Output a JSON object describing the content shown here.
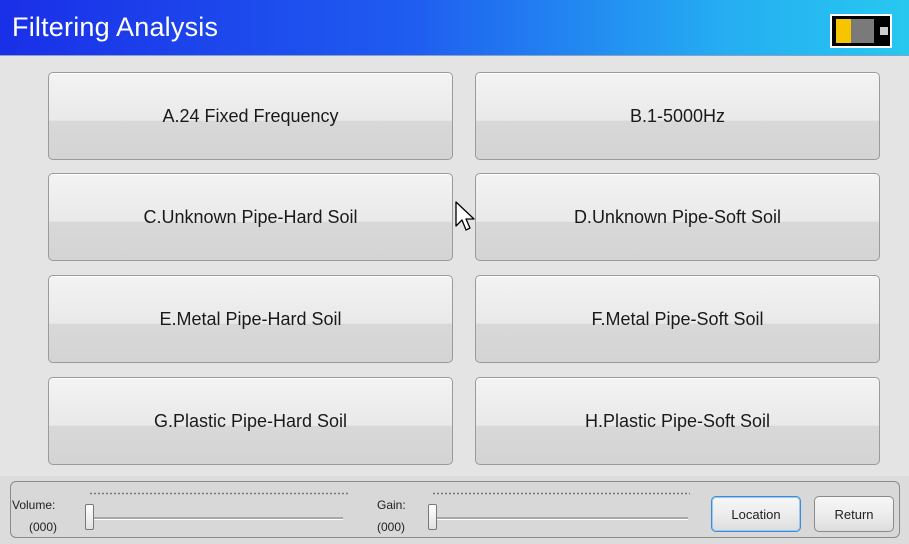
{
  "header": {
    "title": "Filtering Analysis",
    "battery_icon": "battery-icon"
  },
  "menu": {
    "options": [
      "A.24 Fixed Frequency",
      "B.1-5000Hz",
      "C.Unknown Pipe-Hard Soil",
      "D.Unknown Pipe-Soft Soil",
      "E.Metal Pipe-Hard Soil",
      "F.Metal Pipe-Soft Soil",
      "G.Plastic Pipe-Hard Soil",
      "H.Plastic Pipe-Soft Soil"
    ]
  },
  "controls": {
    "volume_label": "Volume:",
    "volume_value": "(000)",
    "gain_label": "Gain:",
    "gain_value": "(000)",
    "location_label": "Location",
    "return_label": "Return"
  },
  "colors": {
    "title_gradient_start": "#1a2fe8",
    "title_gradient_end": "#27c8f0",
    "focus_border": "#3a8cd8"
  }
}
